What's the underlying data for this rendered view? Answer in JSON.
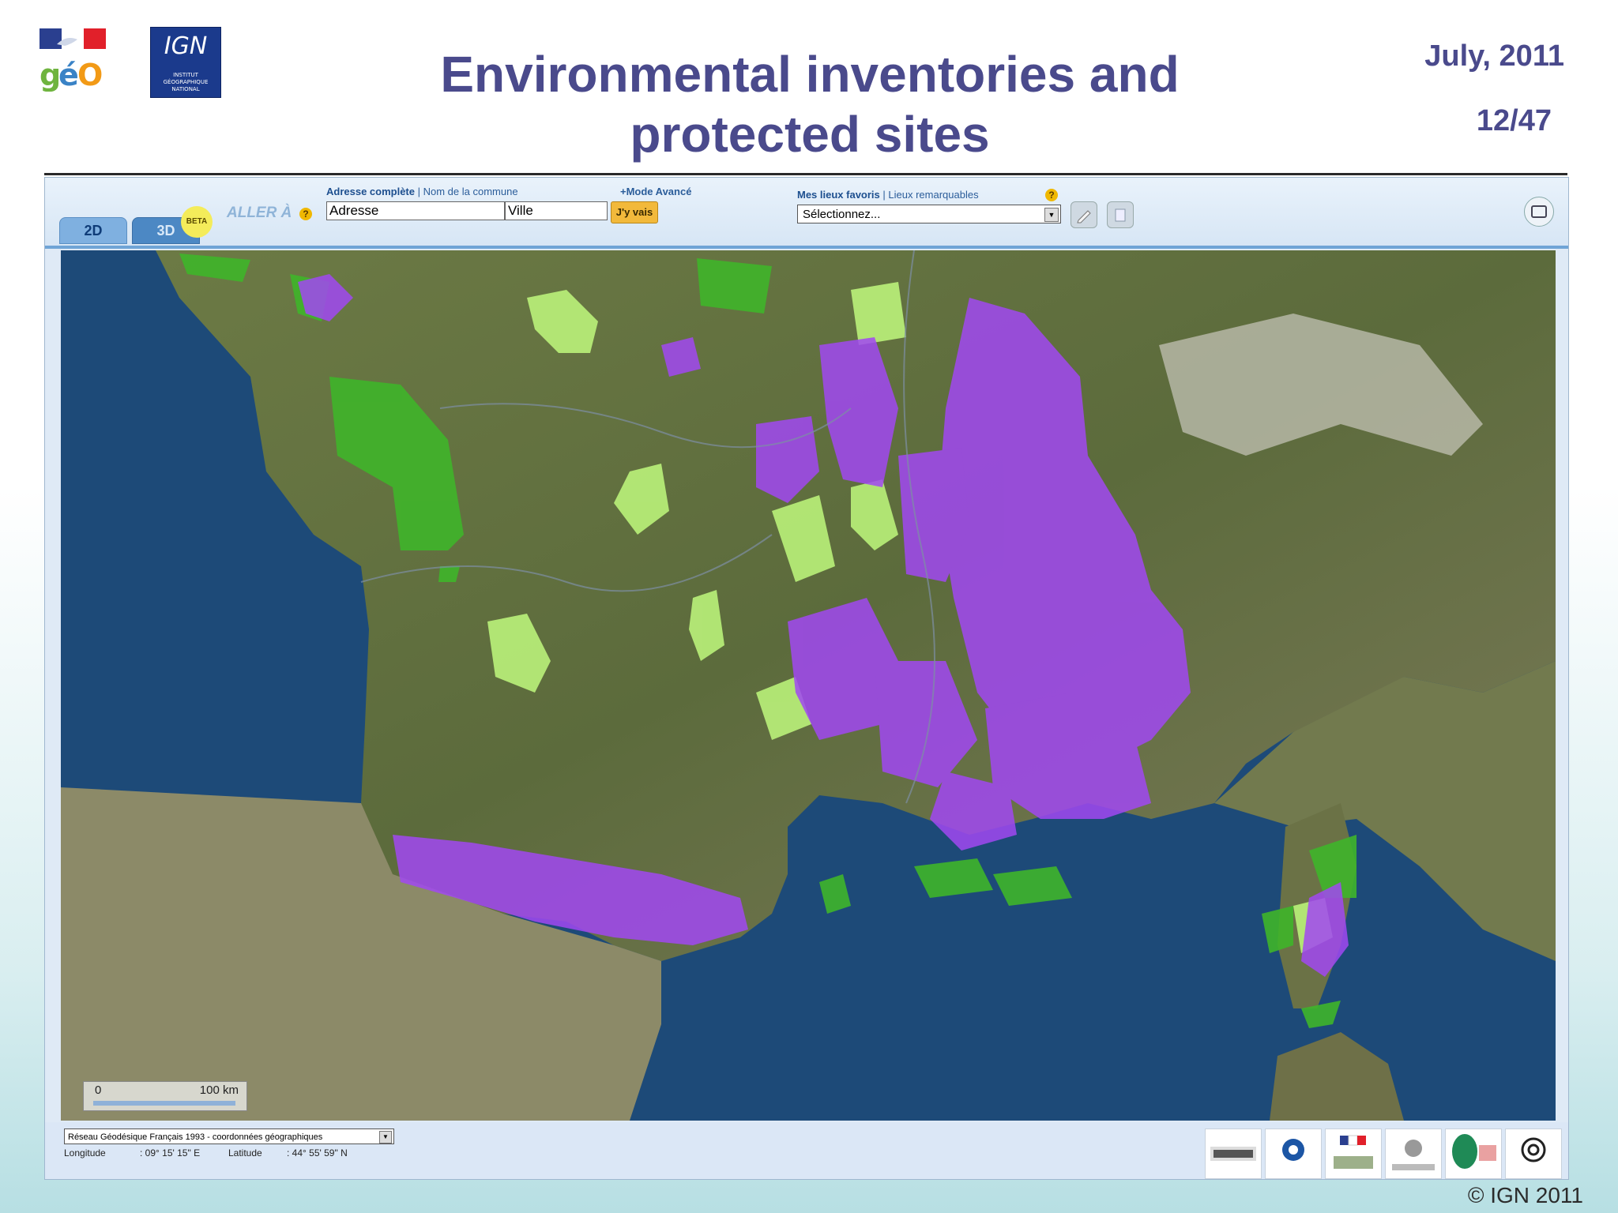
{
  "slide": {
    "title_line1": "Environmental inventories and",
    "title_line2": "protected sites",
    "date": "July,  2011",
    "page": "12/47",
    "copyright": "© IGN 2011"
  },
  "logos": {
    "geo": "géO",
    "ign_main": "IGN",
    "ign_sub": "INSTITUT GÉOGRAPHIQUE NATIONAL"
  },
  "toolbar": {
    "tab_2d": "2D",
    "tab_3d": "3D",
    "beta": "BETA",
    "aller_a": "ALLER À",
    "help": "?",
    "addr_label_main": "Adresse complète",
    "addr_label_sep": " | ",
    "addr_label_alt": "Nom de la commune",
    "mode_avance": "+Mode Avancé",
    "input_adresse": "Adresse",
    "input_ville": "Ville",
    "go_button": "J'y vais",
    "fav_label_main": "Mes lieux favoris",
    "fav_label_sep": " | ",
    "fav_label_alt": "Lieux remarquables",
    "fav_select": "Sélectionnez..."
  },
  "map": {
    "scale_min": "0",
    "scale_max": "100 km",
    "colors": {
      "sea": "#1d4a78",
      "land": "#5b6e3a",
      "znieff_purple": "#a14cf0",
      "natura_green": "#39b22a",
      "light_green": "#b9ee7a",
      "mountains": "#8c8a70"
    }
  },
  "footer": {
    "crs_select": "Réseau Géodésique Français 1993 - coordonnées géographiques",
    "longitude_label": "Longitude",
    "longitude_value": ": 09° 15' 15\" E",
    "latitude_label": "Latitude",
    "latitude_value": ": 44° 55' 59\" N"
  }
}
